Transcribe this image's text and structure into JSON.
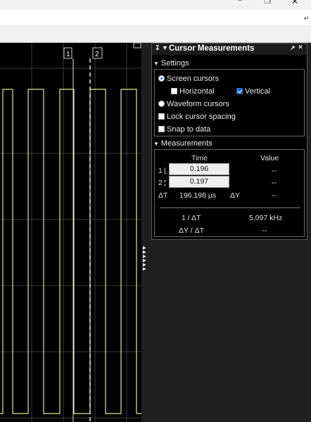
{
  "panel": {
    "title": "Cursor Measurements",
    "settings_header": "Settings",
    "options": {
      "screen_cursors": "Screen cursors",
      "horizontal": "Horizontal",
      "vertical": "Vertical",
      "waveform_cursors": "Waveform cursors",
      "lock_cursor_spacing": "Lock cursor spacing",
      "snap_to_data": "Snap to data"
    },
    "state": {
      "screen_cursors": true,
      "waveform_cursors": false,
      "horizontal": false,
      "vertical": true,
      "lock_cursor_spacing": false,
      "snap_to_data": false
    },
    "measurements_header": "Measurements",
    "col_time": "Time",
    "col_value": "Value",
    "rows": [
      {
        "label": "1",
        "time": "0.196",
        "value": "--"
      },
      {
        "label": "2",
        "time": "0.197",
        "value": "--"
      }
    ],
    "delta_t_label": "ΔT",
    "delta_t_value": "196.198 µs",
    "delta_y_label": "ΔY",
    "delta_y_value": "--",
    "inv_dt_label": "1 / ΔT",
    "inv_dt_value": "5.097 kHz",
    "dy_dt_label": "ΔY / ΔT",
    "dy_dt_value": "--"
  },
  "scope": {
    "cursor1_label": "1",
    "cursor2_label": "2",
    "trace_color": "#e6e68c",
    "cursor_color": "#e0e0e0"
  }
}
